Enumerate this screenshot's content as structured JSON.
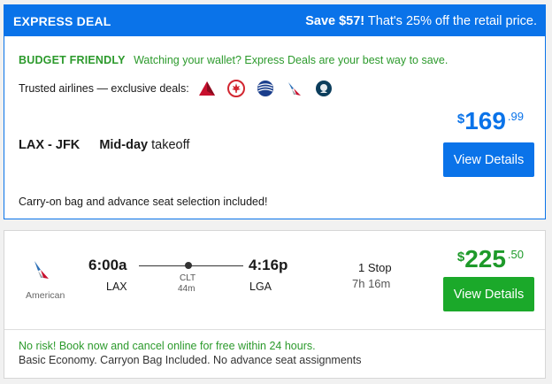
{
  "express": {
    "title": "EXPRESS DEAL",
    "save_amount": "Save $57!",
    "save_text": " That's 25% off the retail price.",
    "budget_tag": "BUDGET FRIENDLY",
    "budget_text": "Watching your wallet? Express Deals are your best way to save.",
    "trusted_label": "Trusted airlines — exclusive deals:",
    "airline_icons": [
      "delta-logo-icon",
      "air-canada-logo-icon",
      "united-logo-icon",
      "american-logo-icon",
      "alaska-logo-icon"
    ],
    "route": "LAX - JFK",
    "takeoff_bold": "Mid-day",
    "takeoff_rest": " takeoff",
    "price_dollar": "$",
    "price_main": "169",
    "price_cents": ".99",
    "button_label": "View Details",
    "carryon_text": "Carry-on bag and advance seat selection included!",
    "accent_color": "#0a73e9"
  },
  "flight": {
    "carrier_name": "American",
    "depart_time": "6:00a",
    "depart_code": "LAX",
    "stop_code": "CLT",
    "stop_duration": "44m",
    "arrive_time": "4:16p",
    "arrive_code": "LGA",
    "stops": "1 Stop",
    "duration": "7h 16m",
    "price_dollar": "$",
    "price_main": "225",
    "price_cents": ".50",
    "button_label": "View Details",
    "norisk_text": "No risk! Book now and cancel online for free within 24 hours.",
    "fare_text": "Basic Economy. Carryon Bag Included. No advance seat assignments",
    "accent_color": "#1ba92a"
  }
}
